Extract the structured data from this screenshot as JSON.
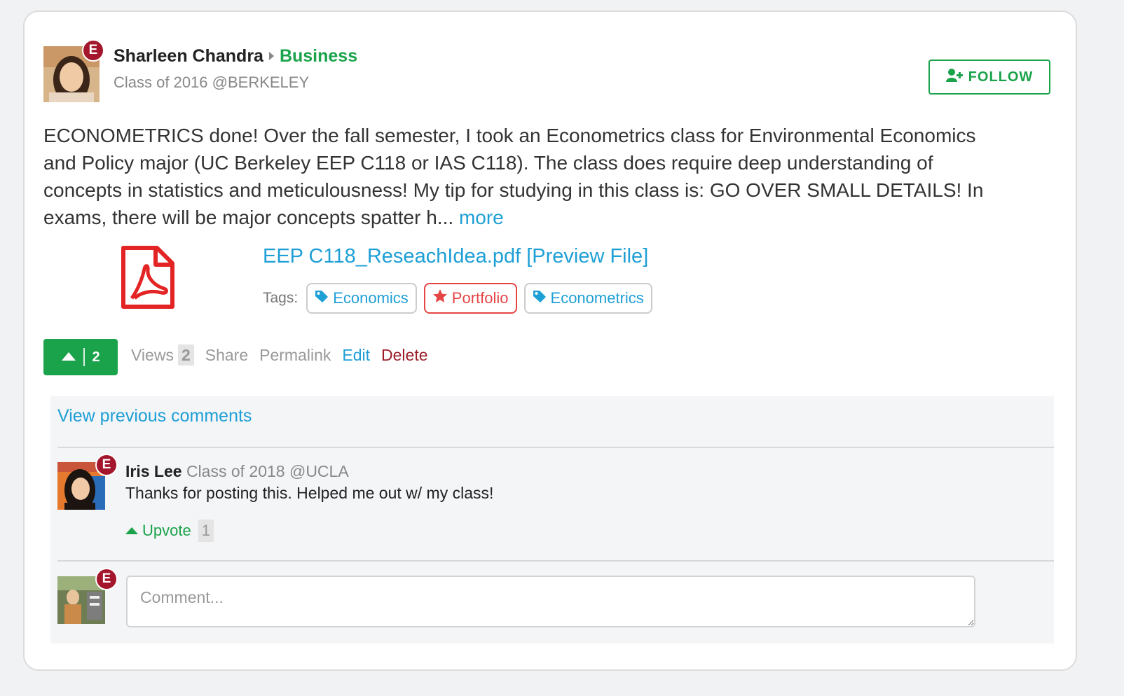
{
  "post": {
    "author": {
      "name": "Sharleen Chandra",
      "category": "Business",
      "subtitle": "Class of 2016 @BERKELEY",
      "badge": "E"
    },
    "follow_label": "FOLLOW",
    "body_text": "ECONOMETRICS done! Over the fall semester, I took an Econometrics class for Environmental Economics and Policy major (UC Berkeley EEP C118 or IAS C118). The class does require deep understanding of concepts in statistics and meticulousness! My tip for studying in this class is: GO OVER SMALL DETAILS! In exams, there will be major concepts spatter h...",
    "more_label": "more",
    "attachment": {
      "file_name": "EEP C118_ReseachIdea.pdf",
      "preview_label": "[Preview File]",
      "icon": "pdf-icon"
    },
    "tags_label": "Tags:",
    "tags": [
      {
        "label": "Economics",
        "icon": "tag-icon"
      },
      {
        "label": "Portfolio",
        "icon": "star-icon"
      },
      {
        "label": "Econometrics",
        "icon": "tag-icon"
      }
    ],
    "upvote_count": "2",
    "actions": {
      "views_label": "Views",
      "views_count": "2",
      "share_label": "Share",
      "permalink_label": "Permalink",
      "edit_label": "Edit",
      "delete_label": "Delete"
    }
  },
  "comments": {
    "view_previous_label": "View previous comments",
    "items": [
      {
        "name": "Iris Lee",
        "subtitle": "Class of 2018 @UCLA",
        "text": "Thanks for posting this. Helped me out w/ my class!",
        "badge": "E",
        "upvote_label": "Upvote",
        "upvote_count": "1"
      }
    ],
    "composer": {
      "badge": "E",
      "placeholder": "Comment..."
    }
  },
  "colors": {
    "green": "#1aa34a",
    "blue_link": "#1e9fd6",
    "badge_red": "#a3162b",
    "delete_red": "#9b1d28",
    "pdf_red": "#e32424"
  }
}
